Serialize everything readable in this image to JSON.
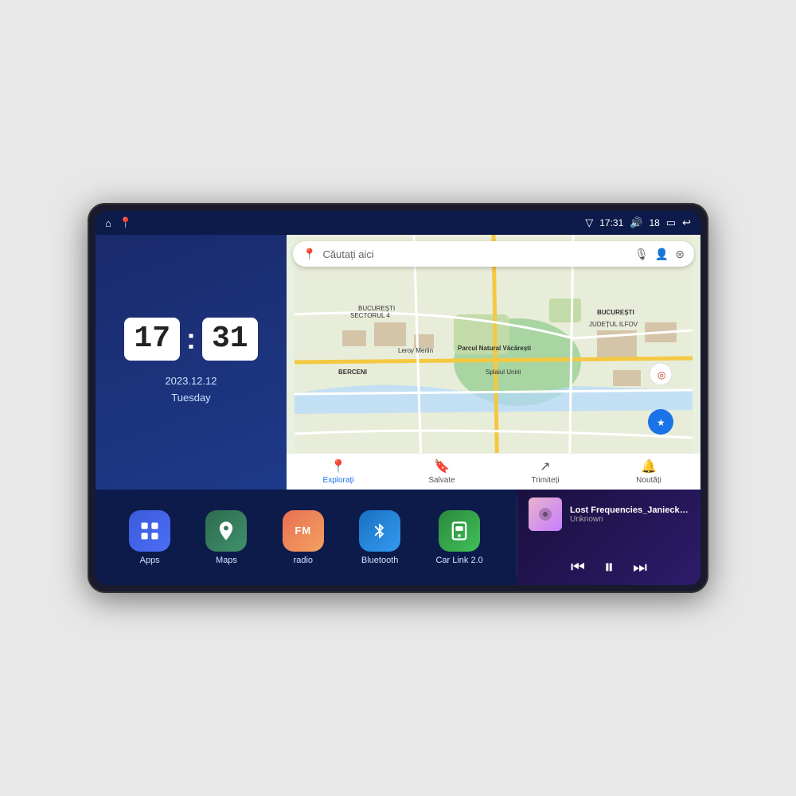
{
  "device": {
    "status_bar": {
      "left_icons": [
        "home",
        "maps"
      ],
      "time": "17:31",
      "signal_icon": "signal",
      "volume_icon": "volume",
      "volume_level": "18",
      "battery_icon": "battery",
      "back_icon": "back"
    }
  },
  "clock_widget": {
    "hours": "17",
    "minutes": "31",
    "date": "2023.12.12",
    "day": "Tuesday"
  },
  "map_widget": {
    "search_placeholder": "Căutați aici",
    "nav_items": [
      {
        "label": "Explorați",
        "icon": "📍",
        "active": true
      },
      {
        "label": "Salvate",
        "icon": "🔖",
        "active": false
      },
      {
        "label": "Trimiteți",
        "icon": "🔃",
        "active": false
      },
      {
        "label": "Noutăți",
        "icon": "🔔",
        "active": false
      }
    ]
  },
  "apps": [
    {
      "id": "apps",
      "label": "Apps",
      "icon": "⊞"
    },
    {
      "id": "maps",
      "label": "Maps",
      "icon": "🗺"
    },
    {
      "id": "radio",
      "label": "radio",
      "icon": "📻"
    },
    {
      "id": "bluetooth",
      "label": "Bluetooth",
      "icon": "🔵"
    },
    {
      "id": "carlink",
      "label": "Car Link 2.0",
      "icon": "📱"
    }
  ],
  "music": {
    "title": "Lost Frequencies_Janieck Devy-...",
    "artist": "Unknown",
    "controls": {
      "prev": "⏮",
      "play": "⏸",
      "next": "⏭"
    }
  }
}
